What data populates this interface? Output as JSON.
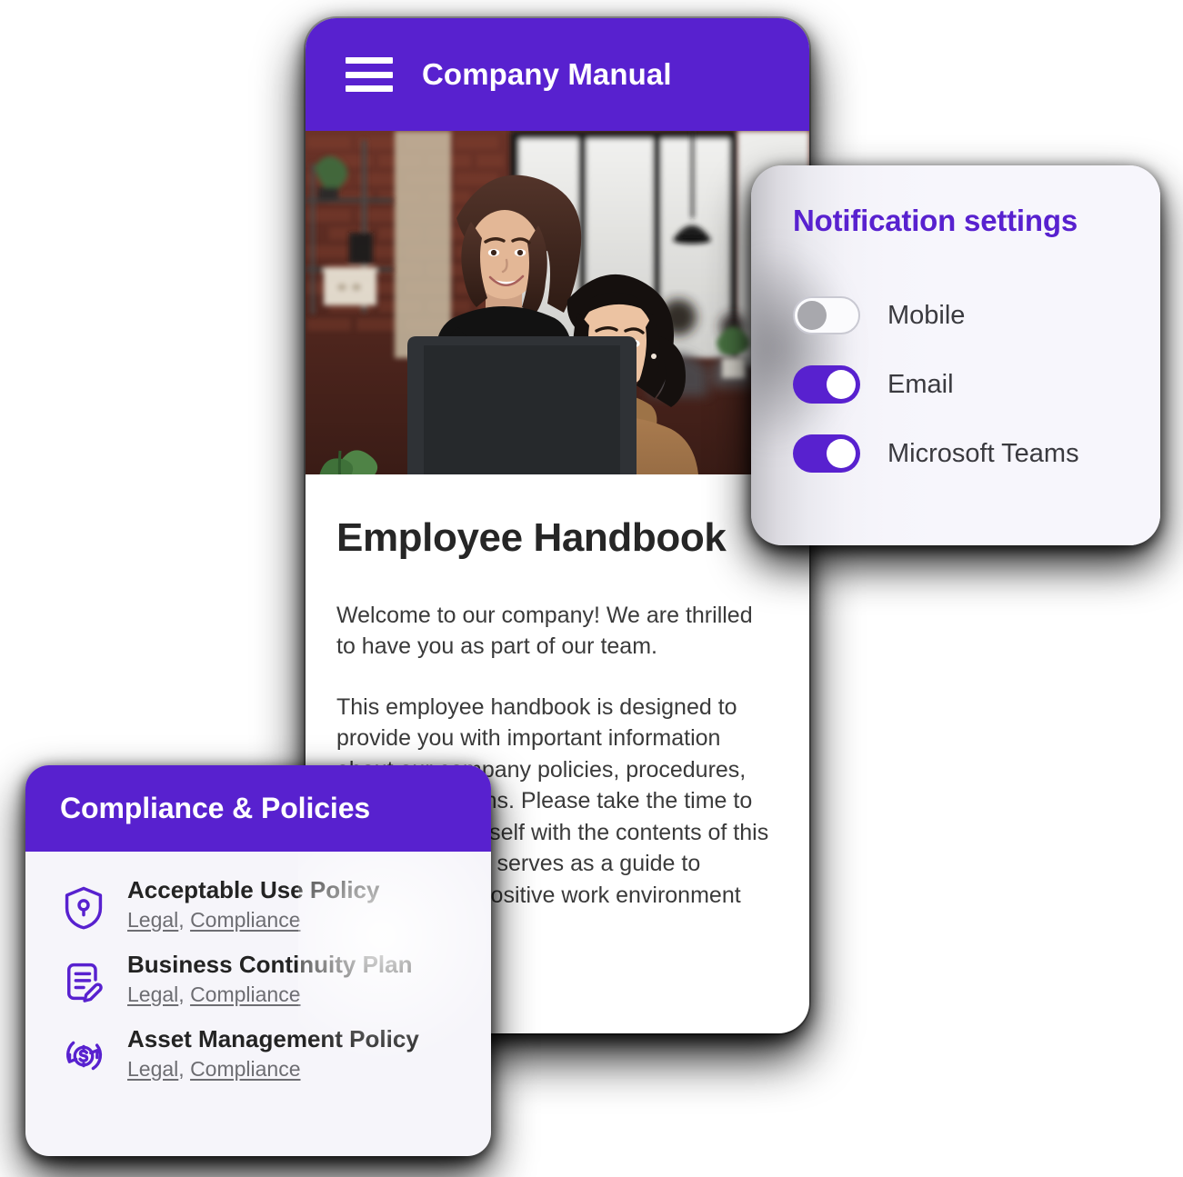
{
  "theme": {
    "brand_purple": "#5821cf",
    "card_bg": "#f6f5fa",
    "page_bg": "#ffffff",
    "text_dark": "#262626",
    "text_muted": "#6d6d72"
  },
  "phone": {
    "appbar": {
      "menu_icon": "hamburger-menu-icon",
      "title": "Company Manual"
    },
    "hero_image_alt": "Two colleagues smiling at a laptop in a brick-walled office",
    "article": {
      "title": "Employee Handbook",
      "paragraphs": [
        "Welcome to our company! We are thrilled to have you as part of our team.",
        "This employee handbook is designed to provide you with important information about our company policies, procedures, and expectations. Please take the time to familiarize yourself with the contents of this handbook, as it serves as a guide to maintaining a positive work environment for everyone."
      ]
    }
  },
  "notification_settings": {
    "title": "Notification settings",
    "toggles": [
      {
        "label": "Mobile",
        "enabled": false,
        "icon": "toggle-off-icon"
      },
      {
        "label": "Email",
        "enabled": true,
        "icon": "toggle-on-icon"
      },
      {
        "label": "Microsoft Teams",
        "enabled": true,
        "icon": "toggle-on-icon"
      }
    ]
  },
  "compliance_card": {
    "header": "Compliance & Policies",
    "policies": [
      {
        "name": "Acceptable Use Policy",
        "icon": "shield-lock-icon",
        "tags": [
          "Legal",
          "Compliance"
        ],
        "tags_separator": ", "
      },
      {
        "name": "Business Continuity Plan",
        "icon": "document-edit-icon",
        "tags": [
          "Legal",
          "Compliance"
        ],
        "tags_separator": ", "
      },
      {
        "name": "Asset Management Policy",
        "icon": "asset-dollar-refresh-icon",
        "tags": [
          "Legal",
          "Compliance"
        ],
        "tags_separator": ", "
      }
    ]
  }
}
